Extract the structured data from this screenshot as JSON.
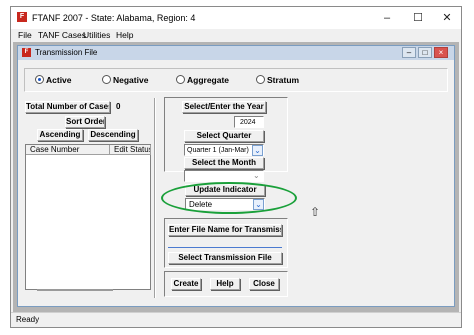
{
  "window": {
    "title": "FTANF 2007 - State: Alabama, Region: 4",
    "minimize_icon": "minimize-icon",
    "maximize_icon": "maximize-icon",
    "close_icon": "close-icon"
  },
  "menu": [
    "File",
    "TANF Cases",
    "Utilities",
    "Help"
  ],
  "child": {
    "title": "Transmission File"
  },
  "radios": {
    "active": "Active",
    "negative": "Negative",
    "aggregate": "Aggregate",
    "stratum": "Stratum",
    "selected": "Active"
  },
  "left": {
    "total_label": "Total Number of Cases :",
    "total_value": "0",
    "sort_order": "Sort Order",
    "ascending": "Ascending",
    "descending": "Descending",
    "columns": [
      "Case Number",
      "Edit Status"
    ]
  },
  "right": {
    "select_year": "Select/Enter the Year",
    "year_value": "2024",
    "select_quarter": "Select Quarter",
    "quarter_value": "Quarter 1 (Jan-Mar)",
    "select_month": "Select the Month",
    "month_value": "",
    "update_indicator": "Update Indicator",
    "update_value": "Delete",
    "enter_file": "Enter File Name for Transmission",
    "file_value": "",
    "select_transmission": "Select Transmission File",
    "create": "Create",
    "help": "Help",
    "close": "Close"
  },
  "status": "Ready",
  "colors": {
    "highlight": "#1aa03a",
    "radio_dot": "#1a56c8",
    "app_icon": "#c8281e"
  }
}
